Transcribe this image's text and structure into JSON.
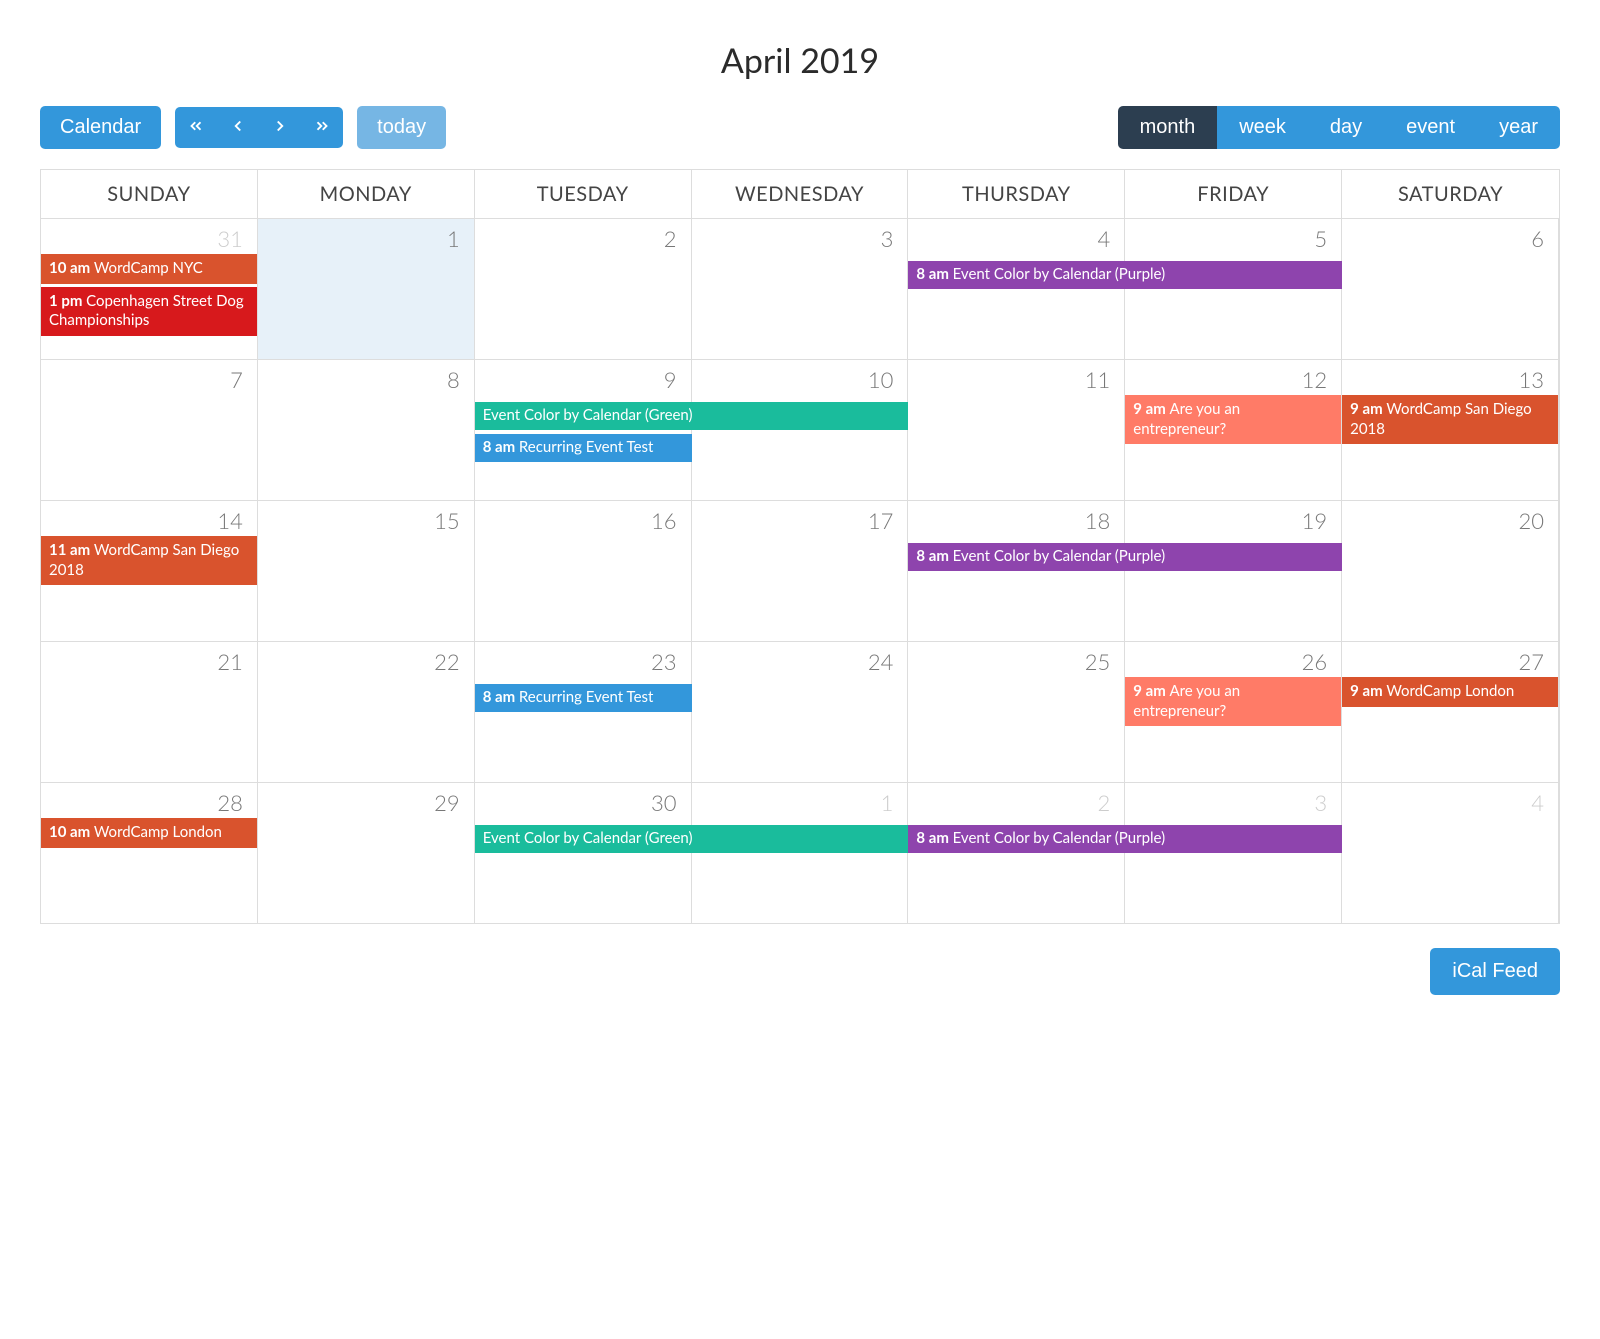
{
  "title": "April 2019",
  "toolbar": {
    "calendar_label": "Calendar",
    "today_label": "today",
    "ical_label": "iCal Feed"
  },
  "views": {
    "month": "month",
    "week": "week",
    "day": "day",
    "event": "event",
    "year": "year",
    "active": "month"
  },
  "day_headers": [
    "SUNDAY",
    "MONDAY",
    "TUESDAY",
    "WEDNESDAY",
    "THURSDAY",
    "FRIDAY",
    "SATURDAY"
  ],
  "colors": {
    "orange": "#d9532d",
    "red": "#d7191c",
    "purple": "#8e44ad",
    "green": "#1abc9c",
    "blue": "#3397db",
    "salmon": "#ff7b67"
  },
  "weeks": [
    {
      "days": [
        {
          "num": "31",
          "other": true
        },
        {
          "num": "1",
          "today": true
        },
        {
          "num": "2"
        },
        {
          "num": "3"
        },
        {
          "num": "4"
        },
        {
          "num": "5"
        },
        {
          "num": "6"
        }
      ],
      "spans": [
        {
          "start": 4,
          "end": 6,
          "color": "purple",
          "time": "8 am",
          "title": "Event Color by Calendar (Purple)"
        }
      ],
      "cell_events": {
        "0": [
          {
            "color": "orange",
            "time": "10 am",
            "title": "WordCamp NYC"
          },
          {
            "color": "red",
            "time": "1 pm",
            "title": "Copenhagen Street Dog Championships"
          }
        ]
      }
    },
    {
      "days": [
        {
          "num": "7"
        },
        {
          "num": "8"
        },
        {
          "num": "9"
        },
        {
          "num": "10"
        },
        {
          "num": "11"
        },
        {
          "num": "12"
        },
        {
          "num": "13"
        }
      ],
      "spans": [
        {
          "start": 2,
          "end": 4,
          "color": "green",
          "title": "Event Color by Calendar (Green)"
        },
        {
          "start": 2,
          "end": 3,
          "color": "blue",
          "time": "8 am",
          "title": "Recurring Event Test",
          "row": 2
        }
      ],
      "cell_events": {
        "5": [
          {
            "color": "salmon",
            "time": "9 am",
            "title": "Are you an entrepreneur?"
          }
        ],
        "6": [
          {
            "color": "orange",
            "time": "9 am",
            "title": "WordCamp San Diego 2018"
          }
        ]
      }
    },
    {
      "days": [
        {
          "num": "14"
        },
        {
          "num": "15"
        },
        {
          "num": "16"
        },
        {
          "num": "17"
        },
        {
          "num": "18"
        },
        {
          "num": "19"
        },
        {
          "num": "20"
        }
      ],
      "spans": [
        {
          "start": 4,
          "end": 6,
          "color": "purple",
          "time": "8 am",
          "title": "Event Color by Calendar (Purple)"
        }
      ],
      "cell_events": {
        "0": [
          {
            "color": "orange",
            "time": "11 am",
            "title": "WordCamp San Diego 2018"
          }
        ]
      }
    },
    {
      "days": [
        {
          "num": "21"
        },
        {
          "num": "22"
        },
        {
          "num": "23"
        },
        {
          "num": "24"
        },
        {
          "num": "25"
        },
        {
          "num": "26"
        },
        {
          "num": "27"
        }
      ],
      "spans": [
        {
          "start": 2,
          "end": 3,
          "color": "blue",
          "time": "8 am",
          "title": "Recurring Event Test"
        }
      ],
      "cell_events": {
        "5": [
          {
            "color": "salmon",
            "time": "9 am",
            "title": "Are you an entrepreneur?"
          }
        ],
        "6": [
          {
            "color": "orange",
            "time": "9 am",
            "title": "WordCamp London"
          }
        ]
      }
    },
    {
      "days": [
        {
          "num": "28"
        },
        {
          "num": "29"
        },
        {
          "num": "30"
        },
        {
          "num": "1",
          "other": true
        },
        {
          "num": "2",
          "other": true
        },
        {
          "num": "3",
          "other": true
        },
        {
          "num": "4",
          "other": true
        }
      ],
      "spans": [
        {
          "start": 2,
          "end": 4,
          "color": "green",
          "title": "Event Color by Calendar (Green)"
        },
        {
          "start": 4,
          "end": 6,
          "color": "purple",
          "time": "8 am",
          "title": "Event Color by Calendar (Purple)"
        }
      ],
      "cell_events": {
        "0": [
          {
            "color": "orange",
            "time": "10 am",
            "title": "WordCamp London"
          }
        ]
      }
    }
  ]
}
